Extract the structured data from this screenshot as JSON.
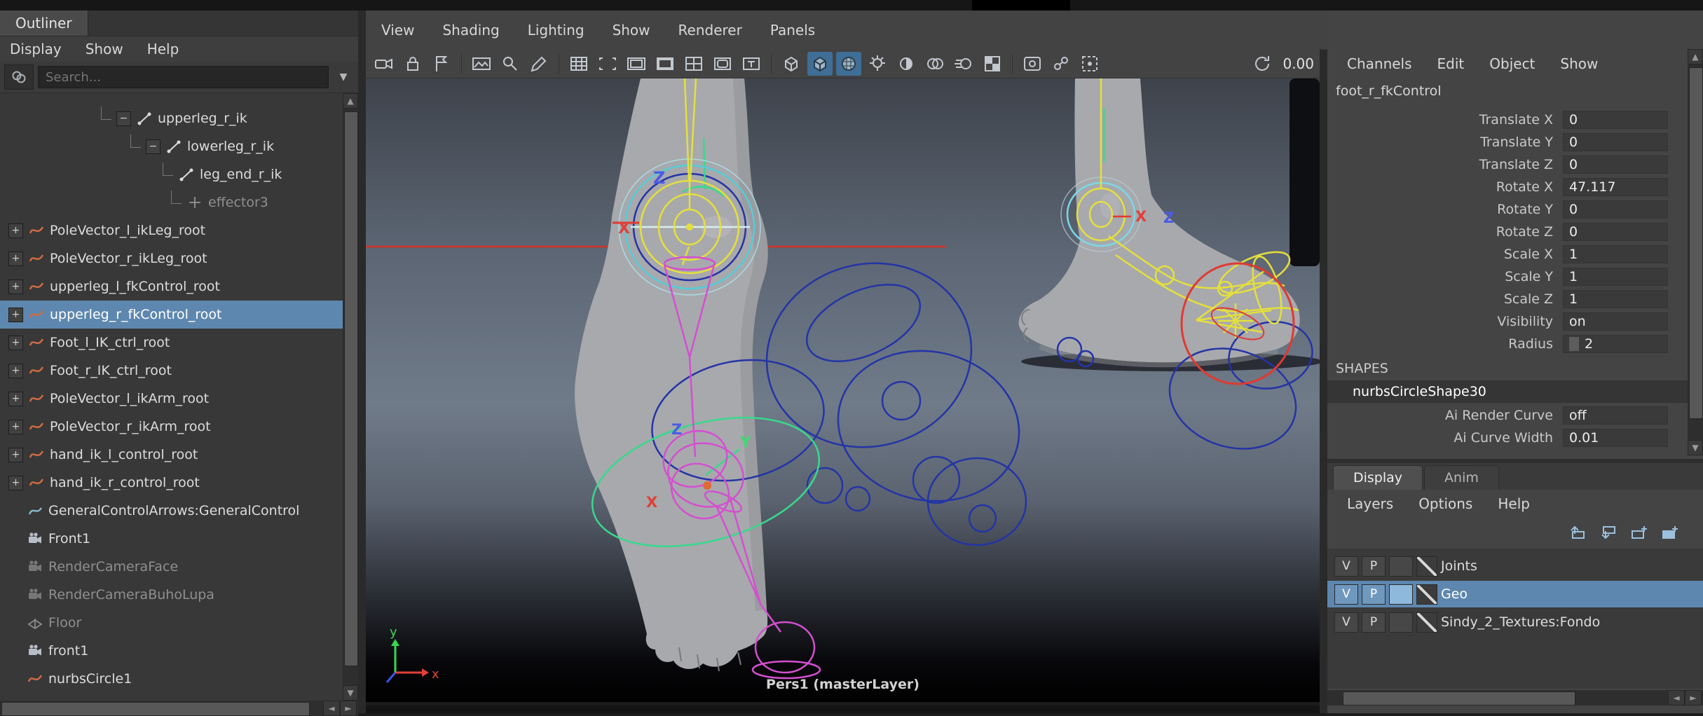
{
  "outliner": {
    "tab": "Outliner",
    "menus": [
      "Display",
      "Show",
      "Help"
    ],
    "search_placeholder": "Search...",
    "items": [
      {
        "label": "upperleg_r_ik",
        "icon": "ik-handle",
        "expanded": true
      },
      {
        "label": "lowerleg_r_ik",
        "icon": "ik-handle",
        "expanded": true
      },
      {
        "label": "leg_end_r_ik",
        "icon": "ik-handle"
      },
      {
        "label": "effector3",
        "icon": "ik-effector",
        "dimmed": true
      },
      {
        "label": "PoleVector_l_ikLeg_root",
        "icon": "nurbs-curve",
        "collapsed": true
      },
      {
        "label": "PoleVector_r_ikLeg_root",
        "icon": "nurbs-curve",
        "collapsed": true
      },
      {
        "label": "upperleg_l_fkControl_root",
        "icon": "nurbs-curve",
        "collapsed": true
      },
      {
        "label": "upperleg_r_fkControl_root",
        "icon": "nurbs-curve",
        "collapsed": true,
        "selected": true
      },
      {
        "label": "Foot_l_IK_ctrl_root",
        "icon": "nurbs-curve",
        "collapsed": true
      },
      {
        "label": "Foot_r_IK_ctrl_root",
        "icon": "nurbs-curve",
        "collapsed": true
      },
      {
        "label": "PoleVector_l_ikArm_root",
        "icon": "nurbs-curve",
        "collapsed": true
      },
      {
        "label": "PoleVector_r_ikArm_root",
        "icon": "nurbs-curve",
        "collapsed": true
      },
      {
        "label": "hand_ik_l_control_root",
        "icon": "nurbs-curve",
        "collapsed": true
      },
      {
        "label": "hand_ik_r_control_root",
        "icon": "nurbs-curve",
        "collapsed": true
      },
      {
        "label": "GeneralControlArrows:GeneralControl",
        "icon": "nurbs-curve-teal"
      },
      {
        "label": "Front1",
        "icon": "camera"
      },
      {
        "label": "RenderCameraFace",
        "icon": "camera",
        "dimmed": true
      },
      {
        "label": "RenderCameraBuhoLupa",
        "icon": "camera",
        "dimmed": true
      },
      {
        "label": "Floor",
        "icon": "locator",
        "dimmed": true
      },
      {
        "label": "front1",
        "icon": "camera"
      },
      {
        "label": "nurbsCircle1",
        "icon": "nurbs-curve"
      }
    ]
  },
  "viewport": {
    "menus": [
      "View",
      "Shading",
      "Lighting",
      "Show",
      "Renderer",
      "Panels"
    ],
    "exposure": "0.00",
    "camera_label": "Pers1 (masterLayer)",
    "labels": {
      "x": "X",
      "y": "Y",
      "z": "Z"
    },
    "axis": {
      "x": "x",
      "y": "y"
    }
  },
  "channel_box": {
    "menus": [
      "Channels",
      "Edit",
      "Object",
      "Show"
    ],
    "object_name": "foot_r_fkControl",
    "attributes": [
      {
        "label": "Translate X",
        "value": "0"
      },
      {
        "label": "Translate Y",
        "value": "0"
      },
      {
        "label": "Translate Z",
        "value": "0"
      },
      {
        "label": "Rotate X",
        "value": "47.117"
      },
      {
        "label": "Rotate Y",
        "value": "0"
      },
      {
        "label": "Rotate Z",
        "value": "0"
      },
      {
        "label": "Scale X",
        "value": "1"
      },
      {
        "label": "Scale Y",
        "value": "1"
      },
      {
        "label": "Scale Z",
        "value": "1"
      },
      {
        "label": "Visibility",
        "value": "on"
      },
      {
        "label": "Radius",
        "value": "2"
      }
    ],
    "shapes_header": "SHAPES",
    "shape_name": "nurbsCircleShape30",
    "shape_attributes": [
      {
        "label": "Ai Render Curve",
        "value": "off"
      },
      {
        "label": "Ai Curve Width",
        "value": "0.01"
      }
    ]
  },
  "layer_editor": {
    "tabs": [
      "Display",
      "Anim"
    ],
    "menus": [
      "Layers",
      "Options",
      "Help"
    ],
    "layers": [
      {
        "v": "V",
        "p": "P",
        "label": "Joints"
      },
      {
        "v": "V",
        "p": "P",
        "label": "Geo",
        "selected": true
      },
      {
        "v": "V",
        "p": "P",
        "label": "Sindy_2_Textures:Fondo"
      }
    ]
  },
  "icons": {
    "expand_open": "−",
    "expand_closed": "+",
    "dropdown_arrow": "▼",
    "scroll_up": "▲",
    "scroll_down": "▼",
    "scroll_left": "◄",
    "scroll_right": "►"
  }
}
